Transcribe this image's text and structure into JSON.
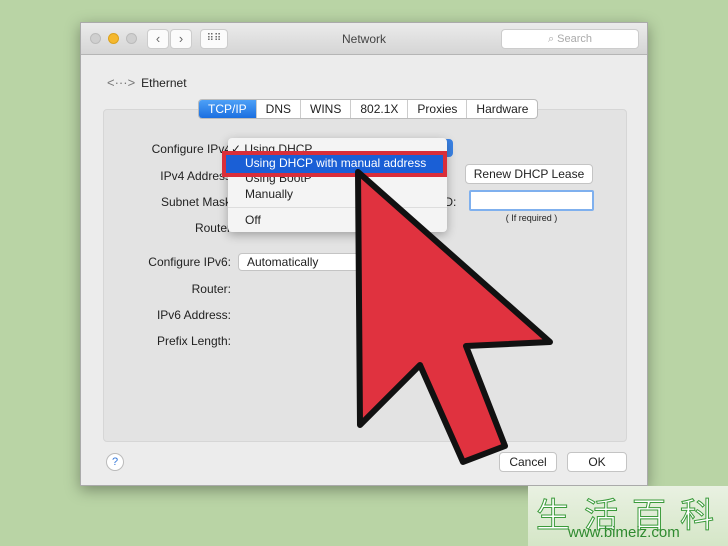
{
  "window": {
    "title": "Network",
    "search_placeholder": "Search"
  },
  "service": {
    "name": "Ethernet"
  },
  "tabs": [
    {
      "label": "TCP/IP",
      "active": true
    },
    {
      "label": "DNS"
    },
    {
      "label": "WINS"
    },
    {
      "label": "802.1X"
    },
    {
      "label": "Proxies"
    },
    {
      "label": "Hardware"
    }
  ],
  "form": {
    "configure_ipv4": "Configure IPv4",
    "ipv4_address": "IPv4 Address",
    "subnet_mask": "Subnet Mask",
    "router": "Router",
    "renew_lease": "Renew DHCP Lease",
    "client_id_label": "ID:",
    "client_id_hint": "( If required )",
    "configure_ipv6": "Configure IPv6:",
    "configure_ipv6_value": "Automatically",
    "router6": "Router:",
    "ipv6_address": "IPv6 Address:",
    "prefix_length": "Prefix Length:"
  },
  "menu": {
    "items": [
      {
        "label": "Using DHCP",
        "checked": true
      },
      {
        "label": "Using DHCP with manual address",
        "highlighted": true
      },
      {
        "label": "Using BootP"
      },
      {
        "label": "Manually"
      },
      {
        "label": "Off"
      }
    ]
  },
  "footer": {
    "help": "?",
    "cancel": "Cancel",
    "ok": "OK"
  },
  "watermark": {
    "chars": "生活百科",
    "url": "www.bimeiz.com"
  },
  "colors": {
    "accent": "#1a5fd6",
    "highlight_box": "#d92e3a",
    "arrow": "#e0323f"
  }
}
